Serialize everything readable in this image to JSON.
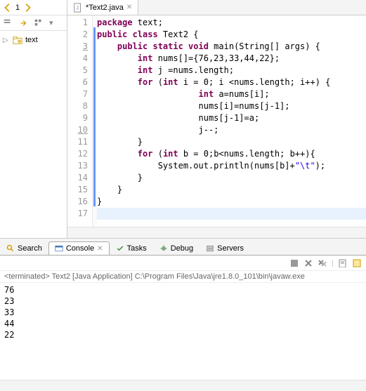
{
  "nav": {
    "counter": "1",
    "tree_item": "text"
  },
  "editor": {
    "tab_label": "*Text2.java",
    "lines": [
      {
        "n": "1",
        "t": "package text;",
        "cls": [
          [
            "kw",
            "package"
          ],
          [
            "",
            " text;"
          ]
        ]
      },
      {
        "n": "2",
        "t": "public class Text2 {",
        "cls": [
          [
            "kw",
            "public class"
          ],
          [
            "",
            " Text2 {"
          ]
        ]
      },
      {
        "n": "3",
        "mark": true,
        "t": "    public static void main(String[] args) {",
        "cls": [
          [
            "",
            "    "
          ],
          [
            "kw",
            "public static void"
          ],
          [
            "",
            " main(String[] args) {"
          ]
        ]
      },
      {
        "n": "4",
        "t": "        int nums[]={76,23,33,44,22};",
        "cls": [
          [
            "",
            "        "
          ],
          [
            "kw",
            "int"
          ],
          [
            "",
            " nums[]={76,23,33,44,22};"
          ]
        ]
      },
      {
        "n": "5",
        "t": "        int j =nums.length;",
        "cls": [
          [
            "",
            "        "
          ],
          [
            "kw",
            "int"
          ],
          [
            "",
            " j =nums.length;"
          ]
        ]
      },
      {
        "n": "6",
        "t": "        for (int i = 0; i <nums.length; i++) {",
        "cls": [
          [
            "",
            "        "
          ],
          [
            "kw",
            "for"
          ],
          [
            "",
            " ("
          ],
          [
            "kw",
            "int"
          ],
          [
            "",
            " i = 0; i <nums.length; i++) {"
          ]
        ]
      },
      {
        "n": "7",
        "t": "                    int a=nums[i];",
        "cls": [
          [
            "",
            "                    "
          ],
          [
            "kw",
            "int"
          ],
          [
            "",
            " a=nums[i];"
          ]
        ]
      },
      {
        "n": "8",
        "t": "                    nums[i]=nums[j-1];",
        "cls": [
          [
            "",
            "                    nums[i]=nums[j-1];"
          ]
        ]
      },
      {
        "n": "9",
        "t": "                    nums[j-1]=a;",
        "cls": [
          [
            "",
            "                    nums[j-1]=a;"
          ]
        ]
      },
      {
        "n": "10",
        "mark": true,
        "t": "                    j--;",
        "cls": [
          [
            "",
            "                    j--;"
          ]
        ]
      },
      {
        "n": "11",
        "t": "        }",
        "cls": [
          [
            "",
            "        }"
          ]
        ]
      },
      {
        "n": "12",
        "t": "        for (int b = 0;b<nums.length; b++){",
        "cls": [
          [
            "",
            "        "
          ],
          [
            "kw",
            "for"
          ],
          [
            "",
            " ("
          ],
          [
            "kw",
            "int"
          ],
          [
            "",
            " b = 0;b<nums.length; b++){"
          ]
        ]
      },
      {
        "n": "13",
        "t": "            System.out.println(nums[b]+\"\\t\");",
        "cls": [
          [
            "",
            "            System.out.println(nums[b]+"
          ],
          [
            "str",
            "\"\\t\""
          ],
          [
            "",
            ");"
          ]
        ]
      },
      {
        "n": "14",
        "t": "        }",
        "cls": [
          [
            "",
            "        }"
          ]
        ]
      },
      {
        "n": "15",
        "t": "    }",
        "cls": [
          [
            "",
            "    }"
          ]
        ]
      },
      {
        "n": "16",
        "t": "}",
        "cls": [
          [
            "",
            "}"
          ]
        ]
      },
      {
        "n": "17",
        "hl": true,
        "t": "",
        "cls": [
          [
            "",
            ""
          ]
        ]
      }
    ]
  },
  "bottom_tabs": {
    "search": "Search",
    "console": "Console",
    "tasks": "Tasks",
    "debug": "Debug",
    "servers": "Servers"
  },
  "console": {
    "status": "<terminated> Text2 [Java Application] C:\\Program Files\\Java\\jre1.8.0_101\\bin\\javaw.exe",
    "output": [
      "76",
      "23",
      "33",
      "44",
      "22"
    ]
  }
}
